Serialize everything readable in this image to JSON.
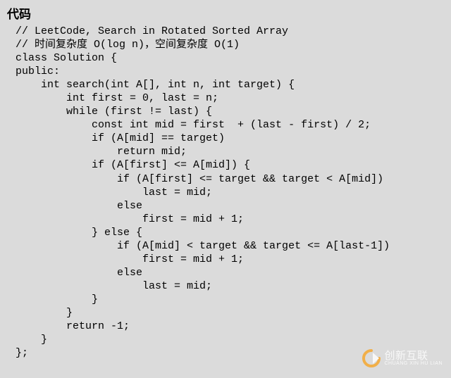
{
  "heading": "代码",
  "code": {
    "l01": "// LeetCode, Search in Rotated Sorted Array",
    "l02": "// 时间复杂度 O(log n)，空间复杂度 O(1)",
    "l03": "class Solution {",
    "l04": "public:",
    "l05": "    int search(int A[], int n, int target) {",
    "l06": "        int first = 0, last = n;",
    "l07": "        while (first != last) {",
    "l08": "            const int mid = first  + (last - first) / 2;",
    "l09": "            if (A[mid] == target)",
    "l10": "                return mid;",
    "l11": "            if (A[first] <= A[mid]) {",
    "l12": "                if (A[first] <= target && target < A[mid])",
    "l13": "                    last = mid;",
    "l14": "                else",
    "l15": "                    first = mid + 1;",
    "l16": "            } else {",
    "l17": "                if (A[mid] < target && target <= A[last-1])",
    "l18": "                    first = mid + 1;",
    "l19": "                else",
    "l20": "                    last = mid;",
    "l21": "            }",
    "l22": "        }",
    "l23": "        return -1;",
    "l24": "    }",
    "l25": "};"
  },
  "watermark": {
    "brand": "创新互联",
    "sub": "CHUANG XIN HU LIAN"
  }
}
